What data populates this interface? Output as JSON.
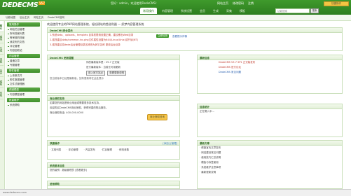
{
  "topbar": {
    "logo": "DEDECMS",
    "version": "V5.7",
    "welcome": "您好：admin，欢迎使用DedeCMS！",
    "links": [
      "网站主页",
      "修改密码",
      "注销"
    ],
    "nav": [
      "常用操作",
      "内容管理",
      "系统设置",
      "会员",
      "生成",
      "采集",
      "模板"
    ],
    "search_placeholder": "功能搜索",
    "search_btn": "搜索",
    "quick_btn": "快捷操作"
  },
  "subbar": [
    "功能地图",
    "后台主页",
    "网站主页",
    "DedeCMS官网"
  ],
  "sidetabs": [
    "核心",
    "模块",
    "生成",
    "采集",
    "会员",
    "模板",
    "系统"
  ],
  "sidebar": [
    {
      "head": "常用操作",
      "items": [
        "网站栏目管理",
        "所有档案列表",
        "等审核的档案",
        "我发布的文档",
        "评论管理",
        "内容回收站"
      ]
    },
    {
      "head": "内容管理",
      "items": [
        "普通文章",
        "专题管理"
      ]
    },
    {
      "head": "附件管理",
      "items": [
        "上传新文件",
        "附件数据管理",
        "文件式管理器"
      ]
    },
    {
      "head": "频道模型",
      "items": [
        "内容模型管理"
      ]
    },
    {
      "head": "批量维护",
      "items": [
        "系统帮助"
      ]
    }
  ],
  "main": {
    "intro": "欢迎使用专业的PHP网站管理系统，轻松建站的首选利器 — 织梦内容管理系统",
    "tip_panel": {
      "title": "DedeCMS安全提示",
      "lines": [
        "1.系统data、uploads、templets 目录权限请设置正确，建议移出Web目录",
        "2.强烈建议data/common.inc.php文件属性设置为644(Linux/Unix)或只读(NT)",
        "3.强烈建议将dede后台管理目录名修改为其它名称 更改后台目录"
      ],
      "btn": "立即检测",
      "link": "查看提示详情"
    },
    "dede_info": {
      "title": "信息中心",
      "lines": [
        "你的最新版本是 : V5.7 正式版",
        "官方最新版本 : 当前无可用更新"
      ]
    },
    "version_panel": {
      "title": "DedeCMS 更新提醒",
      "text": "您当前版本已经是最新版，如有更新将在此处提示",
      "btn1": "进入官方站点",
      "btn2": "查看更新说明"
    },
    "news_panel": {
      "title": "最新信息",
      "items": [
        "DedeCMS V5.7 SP1 正式版发布",
        "DedeCMS 官方论坛",
        "DedeCMS 常见问题"
      ]
    },
    "biz_panel": {
      "title": "商业授权支持",
      "text1": "如果您的网站是商业用途或需要更多技术支持，",
      "text2": "欢迎购买DedeCMS商业授权，获得完善的售后服务。",
      "text3": "商业授权电话: 400-000-0000",
      "btn": "商业授权咨询"
    },
    "quick_panel": {
      "title": "快捷操作",
      "right": "[添加] [管理]",
      "items": [
        "文档列表",
        "评论管理",
        "内容发布",
        "栏目管理",
        "修改参数"
      ]
    },
    "sys_panel": {
      "title": "系统基本信息",
      "text": "您的级别：超级管理员 [查看更多]"
    },
    "stats_panel": {
      "title": "信息统计",
      "text": "正在载入中..."
    },
    "faq_panel": {
      "title": "最新文章",
      "items": [
        "健康宣传文章发布",
        "网站建设常见问题",
        "使用技巧汇总说明",
        "模板与标签使用",
        "系统维护注意事项",
        "最新更新说明"
      ]
    },
    "bottom_panel": {
      "title": "使用帮助"
    }
  },
  "statusbar": "www.dedecms.com"
}
